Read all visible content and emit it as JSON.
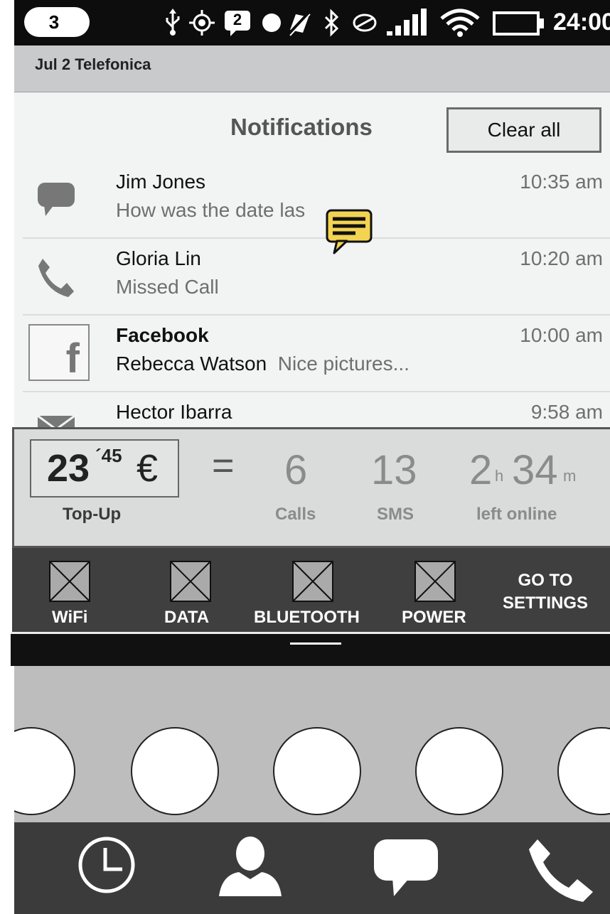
{
  "status_bar": {
    "notification_count": "3",
    "message_badge": "2",
    "time": "24:00",
    "icons": [
      "usb-icon",
      "gps-icon",
      "message-badge-icon",
      "dot-icon",
      "vibrate-off-icon",
      "bluetooth-icon",
      "sync-icon",
      "signal-icon",
      "wifi-icon",
      "battery-icon"
    ]
  },
  "carrier": {
    "text": "Jul 2  Telefonica"
  },
  "notifications": {
    "title": "Notifications",
    "clear_all": "Clear all",
    "items": [
      {
        "icon": "chat-bubble-icon",
        "name": "Jim Jones",
        "message": "How was the date las",
        "time": "10:35 am"
      },
      {
        "icon": "phone-icon",
        "name": "Gloria Lin",
        "message": "Missed Call",
        "time": "10:20 am"
      },
      {
        "icon": "facebook-icon",
        "name": "Facebook",
        "message_strong": "Rebecca Watson",
        "message": "Nice pictures...",
        "time": "10:00 am"
      },
      {
        "icon": "envelope-icon",
        "name": "Hector Ibarra",
        "message": "",
        "time": "9:58 am"
      }
    ],
    "facebook_glyph": "f"
  },
  "topup": {
    "price_main": "23",
    "price_sup": "´45",
    "currency": "€",
    "label": "Top-Up",
    "equals": "=",
    "calls_value": "6",
    "calls_label": "Calls",
    "sms_value": "13",
    "sms_label": "SMS",
    "hours_value": "2",
    "hours_unit": "h",
    "minutes_value": "34",
    "minutes_unit": "m",
    "online_label": "left online"
  },
  "quick_settings": {
    "items": [
      {
        "label": "WiFi",
        "icon": "placeholder-x-icon"
      },
      {
        "label": "DATA",
        "icon": "placeholder-x-icon"
      },
      {
        "label": "BLUETOOTH",
        "icon": "placeholder-x-icon"
      },
      {
        "label": "POWER",
        "icon": "placeholder-x-icon"
      }
    ],
    "goto_line1": "GO TO",
    "goto_line2": "SETTINGS"
  },
  "dock": {
    "icons": [
      "clock-icon",
      "contact-icon",
      "chat-icon",
      "phone-icon"
    ]
  },
  "colors": {
    "accent_note": "#f3d352",
    "panel": "#f2f3f3",
    "dock": "#3b3b3b"
  }
}
